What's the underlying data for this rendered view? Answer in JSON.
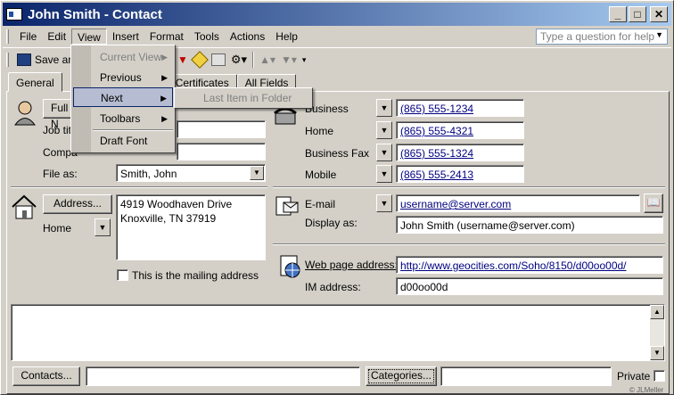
{
  "window": {
    "title": "John Smith  - Contact"
  },
  "menubar": {
    "items": [
      "File",
      "Edit",
      "View",
      "Insert",
      "Format",
      "Tools",
      "Actions",
      "Help"
    ],
    "question_placeholder": "Type a question for help"
  },
  "toolbar": {
    "save_label": "Save and"
  },
  "tabs": [
    "General",
    "Certificates",
    "All Fields"
  ],
  "view_menu": {
    "items": [
      {
        "label": "Current View",
        "disabled": true,
        "submenu": true
      },
      {
        "label": "Previous",
        "disabled": false,
        "submenu": true
      },
      {
        "label": "Next",
        "disabled": false,
        "submenu": true,
        "highlighted": true
      },
      {
        "label": "Toolbars",
        "disabled": false,
        "submenu": true
      },
      {
        "label": "Draft Font",
        "disabled": false,
        "submenu": false
      }
    ],
    "next_submenu": "Last Item in Folder"
  },
  "left": {
    "full_name_button": "Full N",
    "job_title_label": "Job tit",
    "company_label": "Compa",
    "file_as_label": "File as:",
    "file_as_value": "Smith, John",
    "address_button": "Address...",
    "address_type": "Home",
    "address_line1": "4919 Woodhaven Drive",
    "address_line2": "Knoxville, TN  37919",
    "mailing_label": "This is the mailing address"
  },
  "phones": [
    {
      "label": "Business",
      "value": "(865) 555-1234"
    },
    {
      "label": "Home",
      "value": "(865) 555-4321"
    },
    {
      "label": "Business Fax",
      "value": "(865) 555-1324"
    },
    {
      "label": "Mobile",
      "value": "(865) 555-2413"
    }
  ],
  "email": {
    "label": "E-mail",
    "value": "username@server.com",
    "display_as_label": "Display as:",
    "display_as_value": "John Smith (username@server.com)"
  },
  "web": {
    "label": "Web page address:",
    "value": "http://www.geocities.com/Soho/8150/d00oo00d/",
    "im_label": "IM address:",
    "im_value": "d00oo00d"
  },
  "bottom": {
    "contacts_button": "Contacts...",
    "categories_button": "Categories...",
    "private_label": "Private"
  },
  "watermark": "© JLMeller"
}
